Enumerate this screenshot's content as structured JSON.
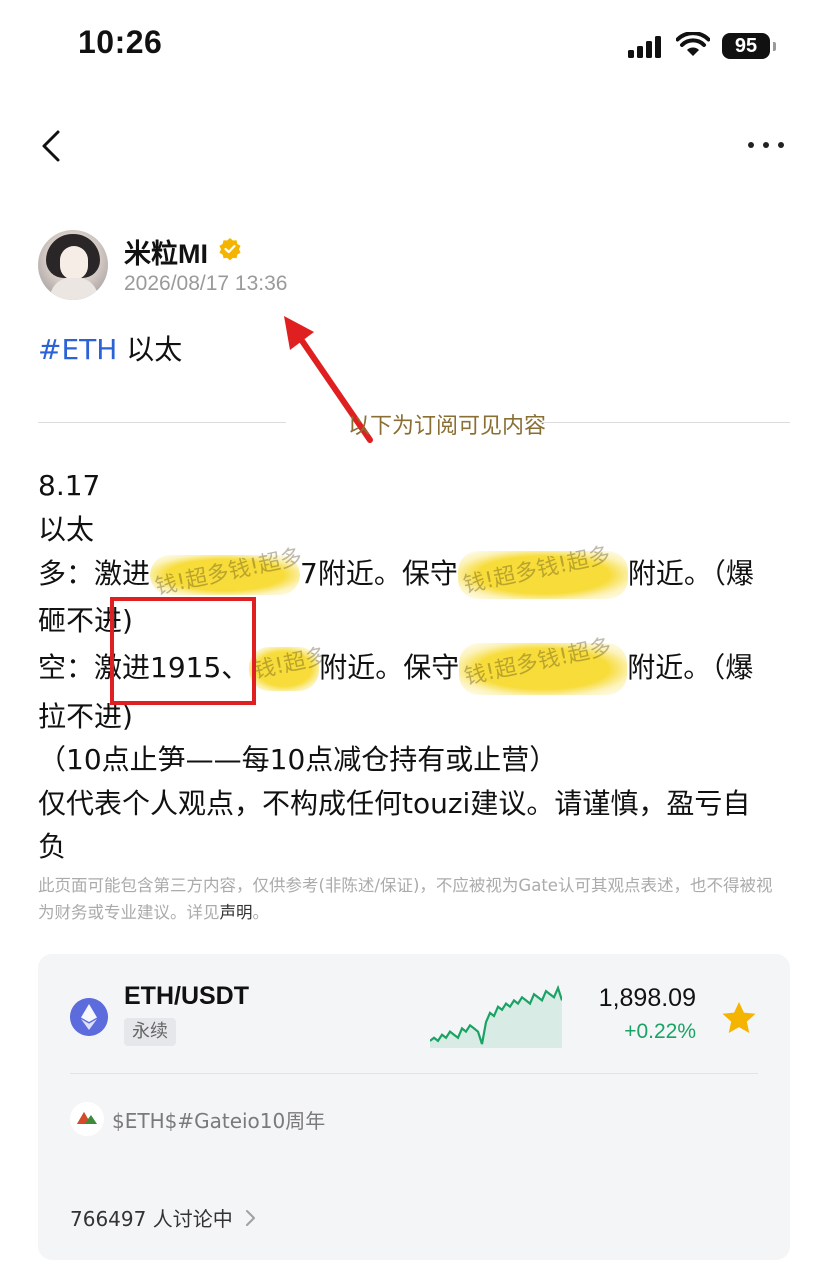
{
  "status_bar": {
    "time": "10:26",
    "battery": "95"
  },
  "author": {
    "name": "米粒MI",
    "timestamp": "2026/08/17 13:36"
  },
  "post": {
    "hashtag": "#ETH",
    "topic": " 以太",
    "divider_label": "以下为订阅可见内容",
    "date": "8.17",
    "asset": "以太",
    "long_prefix": "多：激进",
    "long_mid": "7附近。保守",
    "long_suffix": "附近。（爆",
    "long_wrap": "砸不进)",
    "short_prefix": "空：激进1915、",
    "short_mid": "附近。保守",
    "short_suffix": "附近。（爆",
    "short_wrap": "拉不进)",
    "stop_note": "（10点止笋——每10点减仓持有或止营）",
    "opinion_line1": "仅代表个人观点，不构成任何touzi建议。请谨慎，盈亏自",
    "opinion_line2": "负"
  },
  "disclaimer": {
    "text": "此页面可能包含第三方内容，仅供参考(非陈述/保证)，不应被视为Gate认可其观点表述，也不得被视为财务或专业建议。详见",
    "link": "声明",
    "end": "。"
  },
  "ticker": {
    "pair": "ETH/USDT",
    "badge": "永续",
    "price": "1,898.09",
    "change": "+0.22%",
    "sparkline": [
      3,
      4,
      3,
      5,
      4,
      6,
      5,
      4,
      7,
      6,
      8,
      7,
      6,
      2,
      9,
      12,
      11,
      14,
      13,
      15,
      14,
      16,
      15,
      17,
      16,
      15,
      18,
      17,
      16,
      19,
      18,
      17,
      20,
      16
    ]
  },
  "topic": {
    "text": "$ETH$#Gateio10周年"
  },
  "discussion": {
    "count_text": "766497 人讨论中"
  },
  "colors": {
    "accent": "#2b63d6",
    "positive": "#1aa364",
    "star": "#f5b400",
    "highlight": "#f7dc3a",
    "annotation": "#e02020"
  }
}
